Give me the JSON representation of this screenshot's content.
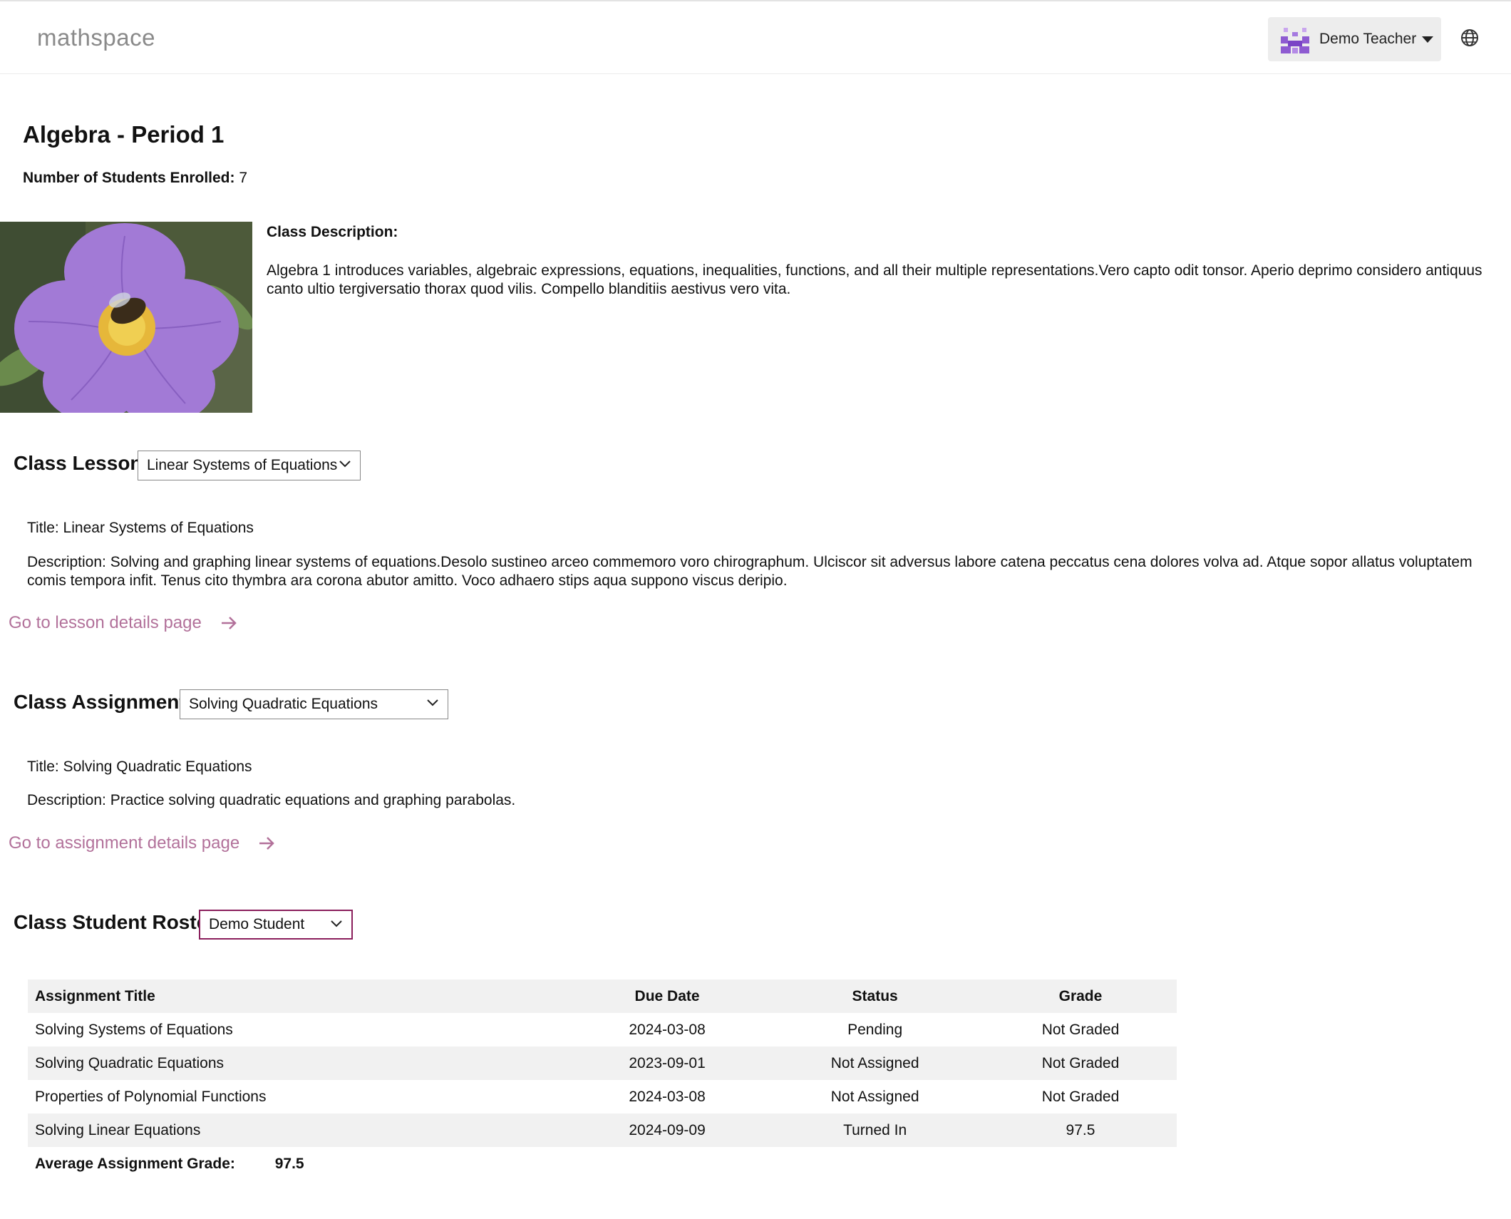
{
  "header": {
    "logo": "mathspace",
    "user_name": "Demo Teacher"
  },
  "class_info": {
    "title": "Algebra - Period 1",
    "enrolled_label": "Number of Students Enrolled:",
    "enrolled_count": "7",
    "description_label": "Class Description:",
    "description": "Algebra 1 introduces variables, algebraic expressions, equations, inequalities, functions, and all their multiple representations.Vero capto odit tonsor. Aperio deprimo considero antiquus canto ultio tergiversatio thorax quod vilis. Compello blanditiis aestivus vero vita."
  },
  "lessons": {
    "label": "Class Lessons:",
    "selected": "Linear Systems of Equations",
    "title_line": "Title: Linear Systems of Equations",
    "description_line": "Description: Solving and graphing linear systems of equations.Desolo sustineo arceo commemoro voro chirographum. Ulciscor sit adversus labore catena peccatus cena dolores volva ad. Atque sopor allatus voluptatem comis tempora infit. Tenus cito thymbra ara corona abutor amitto. Voco adhaero stips aqua suppono viscus deripio.",
    "link_text": "Go to lesson details page"
  },
  "assignments": {
    "label": "Class Assignments:",
    "selected": "Solving Quadratic Equations",
    "title_line": "Title: Solving Quadratic Equations",
    "description_line": "Description: Practice solving quadratic equations and graphing parabolas.",
    "link_text": "Go to assignment details page"
  },
  "roster": {
    "label": "Class Student Roster:",
    "selected": "Demo Student",
    "columns": [
      "Assignment Title",
      "Due Date",
      "Status",
      "Grade"
    ],
    "rows": [
      {
        "title": "Solving Systems of Equations",
        "due": "2024-03-08",
        "status": "Pending",
        "grade": "Not Graded"
      },
      {
        "title": "Solving Quadratic Equations",
        "due": "2023-09-01",
        "status": "Not Assigned",
        "grade": "Not Graded"
      },
      {
        "title": "Properties of Polynomial Functions",
        "due": "2024-03-08",
        "status": "Not Assigned",
        "grade": "Not Graded"
      },
      {
        "title": "Solving Linear Equations",
        "due": "2024-09-09",
        "status": "Turned In",
        "grade": "97.5"
      }
    ],
    "average_label": "Average Assignment Grade:",
    "average_value": "97.5"
  },
  "colors": {
    "link": "#b2719a",
    "active_border": "#8a1f5c",
    "avatar": "#8e5bd1"
  }
}
